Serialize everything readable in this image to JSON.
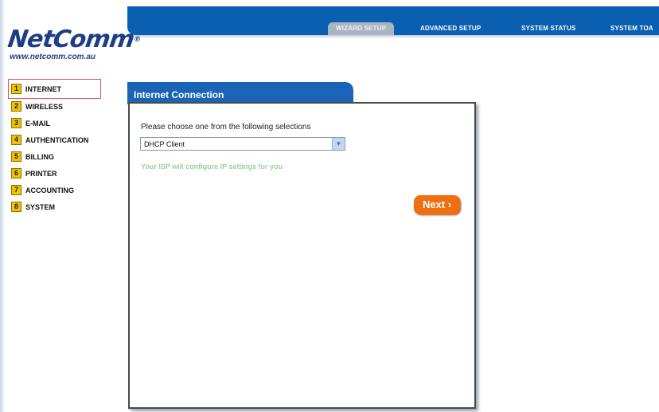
{
  "logo": {
    "name": "NetComm",
    "registered": "®",
    "url": "www.netcomm.com.au"
  },
  "nav": {
    "tabs": [
      {
        "label": "WIZARD SETUP",
        "active": true
      },
      {
        "label": "ADVANCED SETUP",
        "active": false
      },
      {
        "label": "SYSTEM STATUS",
        "active": false
      },
      {
        "label": "SYSTEM TOA",
        "active": false
      }
    ]
  },
  "sidebar": {
    "items": [
      {
        "num": "1",
        "label": "INTERNET",
        "active": true
      },
      {
        "num": "2",
        "label": "WIRELESS"
      },
      {
        "num": "3",
        "label": "E-MAIL"
      },
      {
        "num": "4",
        "label": "AUTHENTICATION"
      },
      {
        "num": "5",
        "label": "BILLING"
      },
      {
        "num": "6",
        "label": "PRINTER"
      },
      {
        "num": "7",
        "label": "ACCOUNTING"
      },
      {
        "num": "8",
        "label": "SYSTEM"
      }
    ]
  },
  "panel": {
    "title": "Internet Connection",
    "prompt": "Please choose one from the following selections",
    "selected_option": "DHCP Client",
    "hint": "Your ISP will configure IP settings for you",
    "next_label": "Next ›"
  },
  "colors": {
    "brand_blue": "#0a5fb0",
    "menu_badge": "#f2c200",
    "next_button": "#ef6f12"
  }
}
